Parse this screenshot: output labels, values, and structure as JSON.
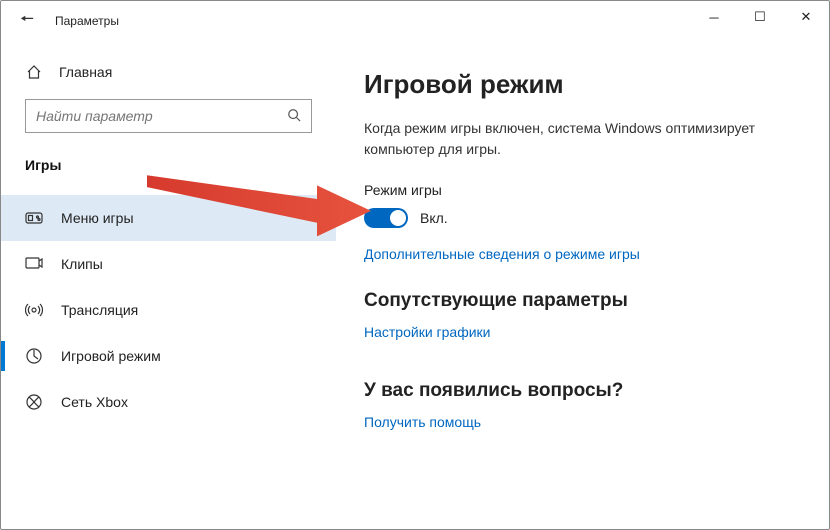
{
  "window": {
    "title": "Параметры"
  },
  "sidebar": {
    "home": "Главная",
    "search_placeholder": "Найти параметр",
    "category": "Игры",
    "items": [
      {
        "label": "Меню игры"
      },
      {
        "label": "Клипы"
      },
      {
        "label": "Трансляция"
      },
      {
        "label": "Игровой режим"
      },
      {
        "label": "Сеть Xbox"
      }
    ]
  },
  "content": {
    "title": "Игровой режим",
    "description": "Когда режим игры включен, система Windows оптимизирует компьютер для игры.",
    "toggle_section_label": "Режим игры",
    "toggle_state_label": "Вкл.",
    "more_info_link": "Дополнительные сведения о режиме игры",
    "related_heading": "Сопутствующие параметры",
    "graphics_link": "Настройки графики",
    "questions_heading": "У вас появились вопросы?",
    "help_link": "Получить помощь"
  }
}
